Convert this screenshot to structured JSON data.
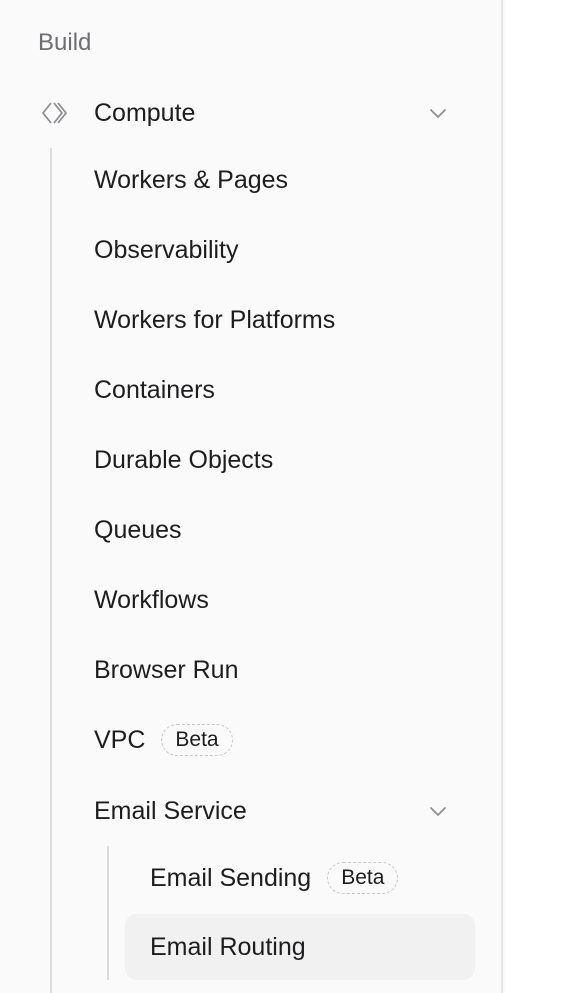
{
  "sidebar": {
    "section_label": "Build",
    "group": {
      "label": "Compute",
      "icon": "compute-icon"
    },
    "items": [
      {
        "label": "Workers & Pages"
      },
      {
        "label": "Observability"
      },
      {
        "label": "Workers for Platforms"
      },
      {
        "label": "Containers"
      },
      {
        "label": "Durable Objects"
      },
      {
        "label": "Queues"
      },
      {
        "label": "Workflows"
      },
      {
        "label": "Browser Run"
      },
      {
        "label": "VPC",
        "badge": "Beta"
      }
    ],
    "subgroup": {
      "label": "Email Service",
      "items": [
        {
          "label": "Email Sending",
          "badge": "Beta"
        },
        {
          "label": "Email Routing",
          "active": true
        }
      ]
    }
  },
  "colors": {
    "background": "#fafafa",
    "text": "#1d1d1f",
    "muted": "#6e6e73",
    "active_bg": "#f1f1f1",
    "tree_line": "#dcdcdc"
  }
}
